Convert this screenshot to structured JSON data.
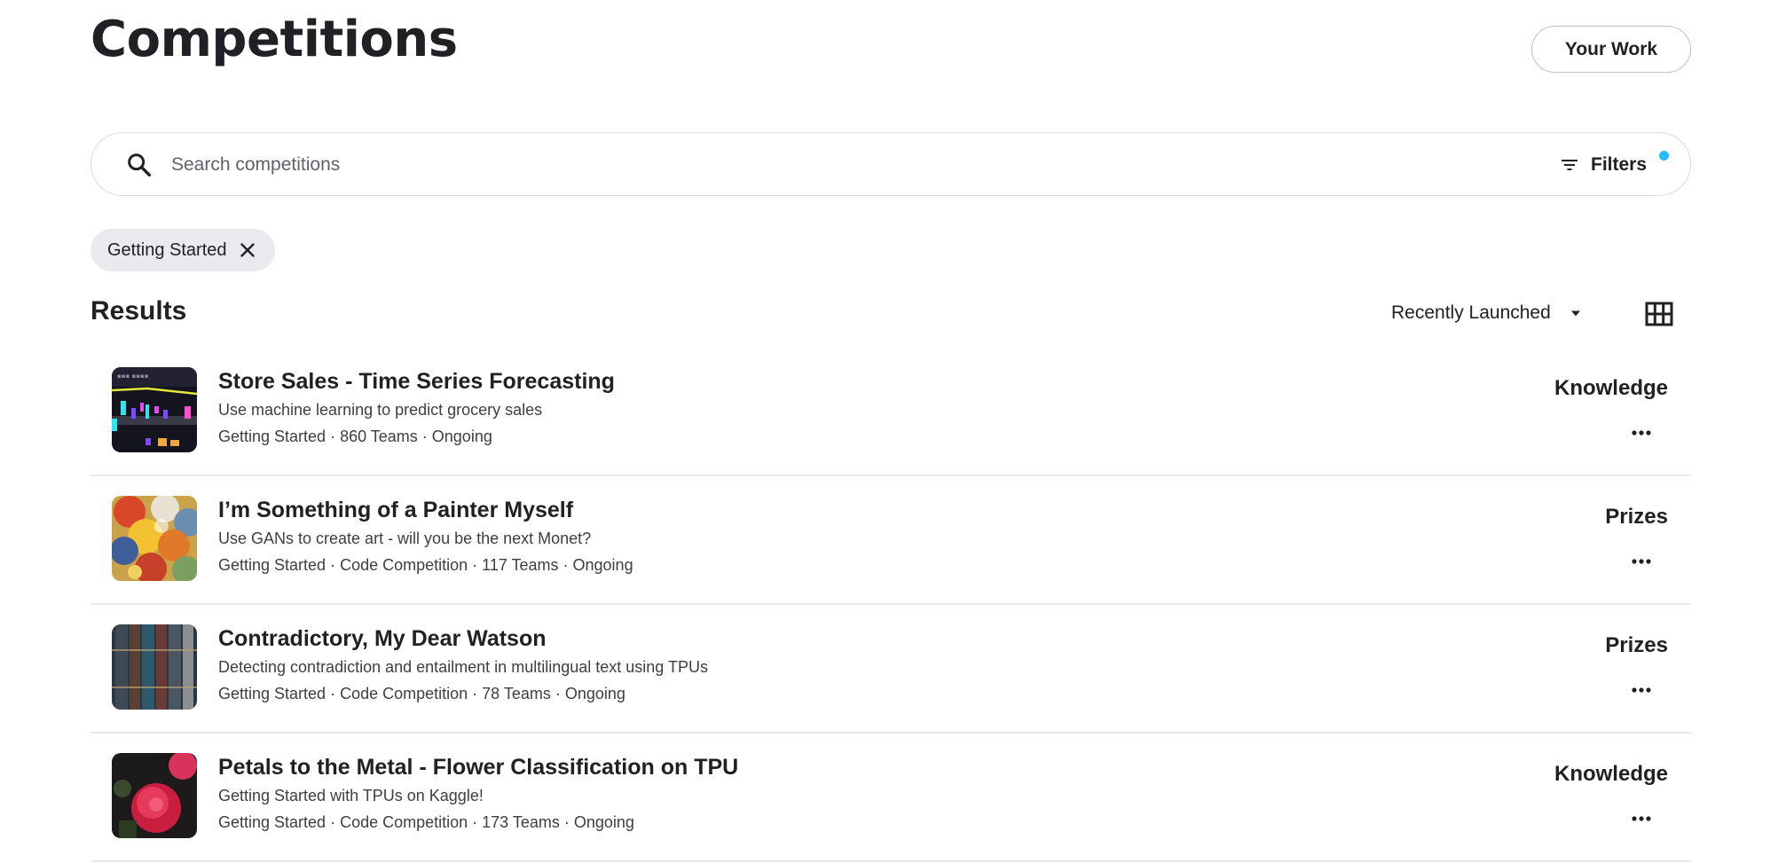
{
  "header": {
    "title": "Competitions",
    "your_work_label": "Your Work"
  },
  "search": {
    "placeholder": "Search competitions",
    "value": "",
    "filters_label": "Filters",
    "filters_active_color": "#20beff"
  },
  "active_filters": [
    {
      "label": "Getting Started"
    }
  ],
  "results": {
    "title": "Results",
    "sort_label": "Recently Launched",
    "view_mode": "grid"
  },
  "competitions": [
    {
      "title": "Store Sales - Time Series Forecasting",
      "description": "Use machine learning to predict grocery sales",
      "meta": "Getting Started · 860 Teams · Ongoing",
      "reward": "Knowledge"
    },
    {
      "title": "I’m Something of a Painter Myself",
      "description": "Use GANs to create art - will you be the next Monet?",
      "meta": "Getting Started · Code Competition · 117 Teams · Ongoing",
      "reward": "Prizes"
    },
    {
      "title": "Contradictory, My Dear Watson",
      "description": "Detecting contradiction and entailment in multilingual text using TPUs",
      "meta": "Getting Started · Code Competition · 78 Teams · Ongoing",
      "reward": "Prizes"
    },
    {
      "title": "Petals to the Metal - Flower Classification on TPU",
      "description": "Getting Started with TPUs on Kaggle!",
      "meta": "Getting Started · Code Competition · 173 Teams · Ongoing",
      "reward": "Knowledge"
    }
  ]
}
